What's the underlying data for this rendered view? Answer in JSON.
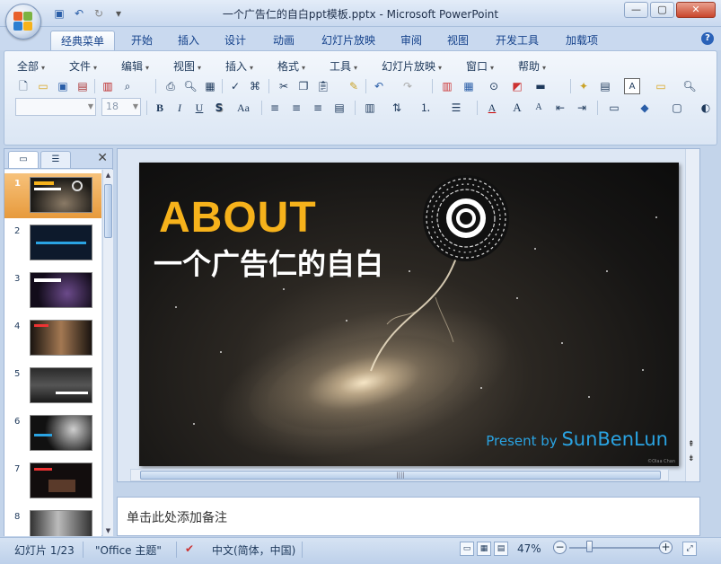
{
  "window": {
    "title": "一个广告仁的自白ppt模板.pptx - Microsoft PowerPoint",
    "controls": [
      "—",
      "▢",
      "✕"
    ]
  },
  "quick_access": [
    "save-icon",
    "undo-icon",
    "redo-icon",
    "customize-icon"
  ],
  "tabs": [
    {
      "label": "经典菜单",
      "active": true
    },
    {
      "label": "开始"
    },
    {
      "label": "插入"
    },
    {
      "label": "设计"
    },
    {
      "label": "动画"
    },
    {
      "label": "幻灯片放映"
    },
    {
      "label": "审阅"
    },
    {
      "label": "视图"
    },
    {
      "label": "开发工具"
    },
    {
      "label": "加载项"
    }
  ],
  "classic_menu": [
    "全部",
    "文件",
    "编辑",
    "视图",
    "插入",
    "格式",
    "工具",
    "幻灯片放映",
    "窗口",
    "帮助"
  ],
  "format_bar": {
    "font_name": "",
    "font_size": "18",
    "bold": "B",
    "italic": "I",
    "underline": "U",
    "shadow": "S",
    "change_case": "Aa",
    "font_color": "A",
    "grow_font": "A",
    "shrink_font": "A"
  },
  "panel": {
    "tab_slides": "slides-tab",
    "tab_outline": "outline-tab",
    "close": "✕"
  },
  "slides": [
    {
      "num": "1",
      "selected": true
    },
    {
      "num": "2"
    },
    {
      "num": "3"
    },
    {
      "num": "4"
    },
    {
      "num": "5"
    },
    {
      "num": "6"
    },
    {
      "num": "7"
    },
    {
      "num": "8"
    }
  ],
  "slide": {
    "heading": "ABOUT",
    "subtitle": "一个广告仁的自白",
    "present_prefix": "Present by ",
    "presenter": "SunBenLun",
    "credit": "©Olaa Chan",
    "colors": {
      "heading": "#f6b21b",
      "presenter": "#2aa3e2"
    }
  },
  "notes": {
    "placeholder": "单击此处添加备注"
  },
  "status": {
    "slide_info": "幻灯片 1/23",
    "theme": "\"Office 主题\"",
    "language": "中文(简体，中国)",
    "zoom": "47%"
  }
}
